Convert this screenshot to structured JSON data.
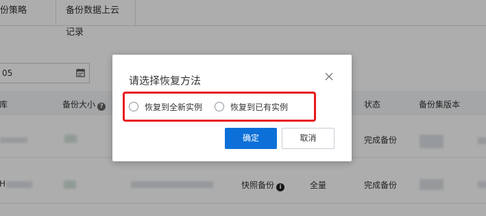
{
  "tabs": [
    {
      "label": "份策略"
    },
    {
      "label": "备份数据上云记录"
    }
  ],
  "date_filter": {
    "value": "05"
  },
  "table": {
    "headers": [
      "库",
      "备份大小",
      "状态",
      "备份集版本"
    ],
    "rows": [
      {
        "col_type": "",
        "col_mode": "",
        "col_status": "完成备份"
      },
      {
        "col_type": "快照备份",
        "col_mode": "全量",
        "col_status": "完成备份",
        "col_db_prefix": "H"
      }
    ]
  },
  "dialog": {
    "title": "请选择恢复方法",
    "options": [
      {
        "label": "恢复到全新实例"
      },
      {
        "label": "恢复到已有实例"
      }
    ],
    "ok_label": "确定",
    "cancel_label": "取消"
  },
  "colors": {
    "primary": "#0d70d8",
    "highlight_border": "#e8161b",
    "mask": "rgba(0,0,0,0.32)"
  },
  "icons": [
    "calendar-icon",
    "help-icon",
    "info-icon",
    "close-icon"
  ]
}
